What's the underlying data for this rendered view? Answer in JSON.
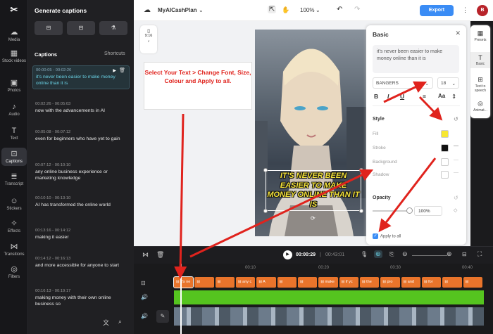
{
  "rail": {
    "items": [
      {
        "label": "Media",
        "icon": "media-icon"
      },
      {
        "label": "Stock videos",
        "icon": "stock-videos-icon"
      },
      {
        "label": "Photos",
        "icon": "photos-icon"
      },
      {
        "label": "Audio",
        "icon": "audio-icon"
      },
      {
        "label": "Text",
        "icon": "text-icon"
      },
      {
        "label": "Captions",
        "icon": "captions-icon"
      },
      {
        "label": "Transcript",
        "icon": "transcript-icon"
      },
      {
        "label": "Stickers",
        "icon": "stickers-icon"
      },
      {
        "label": "Effects",
        "icon": "effects-icon"
      },
      {
        "label": "Transitions",
        "icon": "transitions-icon"
      },
      {
        "label": "Filters",
        "icon": "filters-icon"
      }
    ]
  },
  "panel": {
    "title": "Generate captions",
    "captions_header": "Captions",
    "shortcuts": "Shortcuts",
    "captions": [
      {
        "time": "00:00:05 - 00:02:26",
        "text": "it's never been easier to make money online than it is"
      },
      {
        "time": "00:02:26 - 00:05:03",
        "text": "now with the advancements in AI"
      },
      {
        "time": "00:05:08 - 00:07:12",
        "text": "even for beginners who have yet to gain"
      },
      {
        "time": "00:07:12 - 00:10:10",
        "text": "any online business experience or marketing knowledge"
      },
      {
        "time": "00:10:10 - 00:13:10",
        "text": "AI has transformed the online world"
      },
      {
        "time": "00:13:16 - 00:14:12",
        "text": "making it easier"
      },
      {
        "time": "00:14:12 - 00:16:13",
        "text": "and more accessible for anyone to start"
      },
      {
        "time": "00:16:13 - 00:19:17",
        "text": "making money with their own online business so"
      }
    ]
  },
  "topbar": {
    "project": "MyAICashPlan",
    "zoom": "100%",
    "export": "Export",
    "avatar": "B"
  },
  "canvas": {
    "aspect": "9:16",
    "instruction": "Select Your Text > Change Font, Size, Colour and Apply to all.",
    "caption_overlay": "IT'S NEVER BEEN EASIER TO MAKE MONEY ONLINE THAN IT IS"
  },
  "basic": {
    "title": "Basic",
    "text": "it's never been easier to make money online than it is",
    "font": "BANGERS",
    "size": "18",
    "style": "Style",
    "fill": "Fill",
    "stroke": "Stroke",
    "background": "Background",
    "shadow": "Shadow",
    "opacity": "Opacity",
    "opacity_value": "100%",
    "apply_all": "Apply to all",
    "fill_color": "#f7e731",
    "stroke_color": "#111111"
  },
  "right_tabs": [
    {
      "label": "Presets",
      "icon": "presets-icon"
    },
    {
      "label": "Basic",
      "icon": "basic-text-icon"
    },
    {
      "label": "Text to speech",
      "icon": "speech-icon"
    },
    {
      "label": "Animat...",
      "icon": "animation-icon"
    }
  ],
  "playback": {
    "current": "00:00:29",
    "total": "00:43:01"
  },
  "timeline": {
    "ticks": [
      "00:10",
      "00:20",
      "00:30",
      "00:40"
    ],
    "chips": [
      "it's ne",
      "",
      "",
      "any c",
      "A",
      "",
      "",
      "make",
      "if yc",
      "the",
      "pro",
      "and",
      "for",
      "",
      ""
    ]
  }
}
